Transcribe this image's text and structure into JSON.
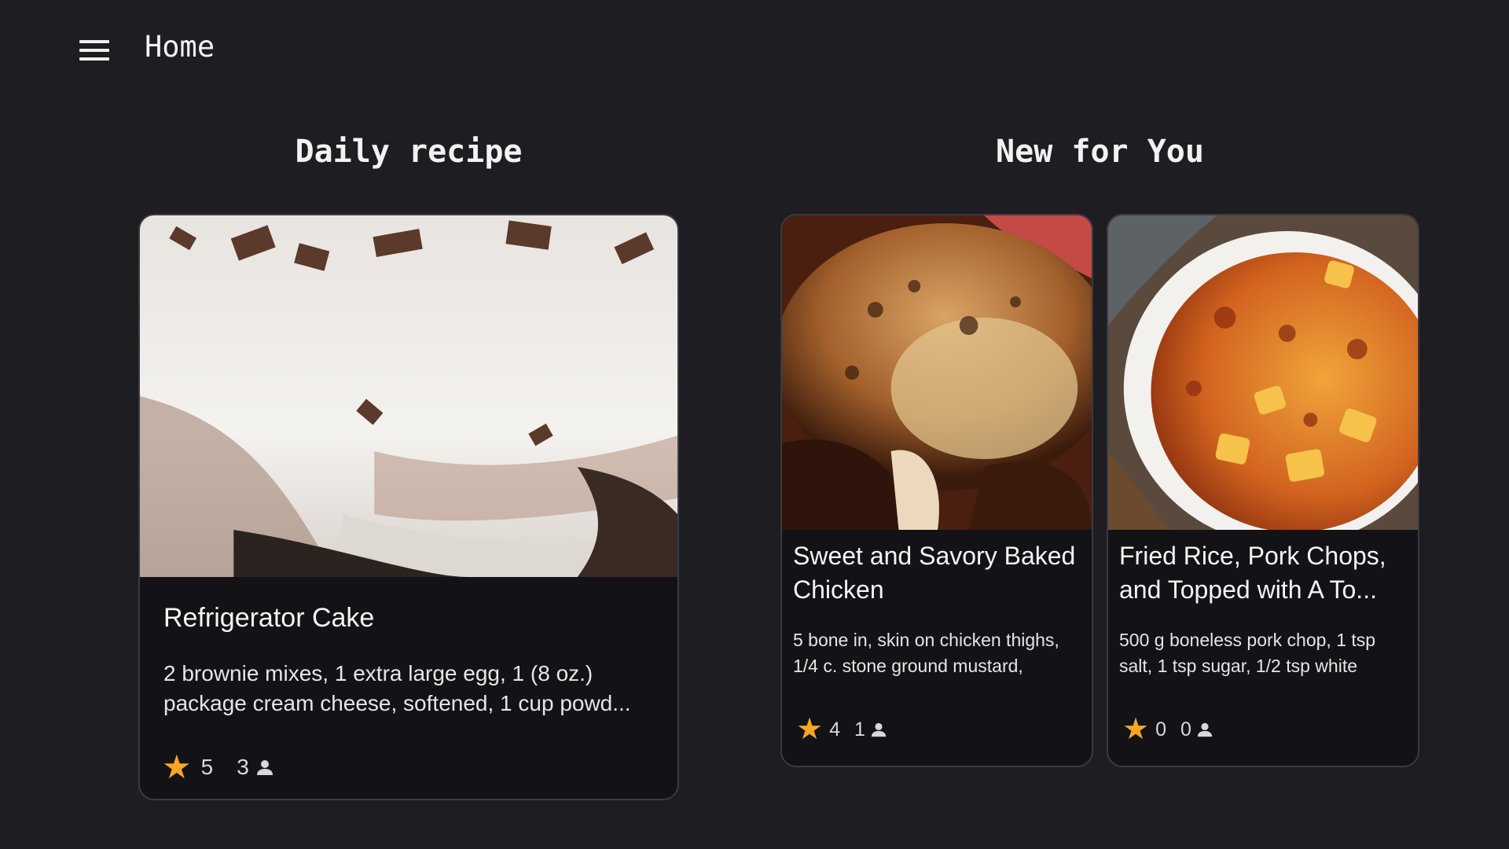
{
  "header": {
    "title": "Home",
    "menu_icon": "hamburger-menu-icon"
  },
  "sections": {
    "daily": {
      "title": "Daily recipe"
    },
    "new_for_you": {
      "title": "New for You"
    }
  },
  "daily_recipe": {
    "title": "Refrigerator Cake",
    "description": "2 brownie mixes, 1 extra large egg, 1 (8 oz.) package cream cheese, softened, 1 cup powd...",
    "rating": "5",
    "reviews": "3"
  },
  "new_recipes": [
    {
      "title": "Sweet and Savory Baked Chicken",
      "description": "5 bone in, skin on chicken thighs, 1/4 c. stone ground mustard,",
      "rating": "4",
      "reviews": "1"
    },
    {
      "title": "Fried Rice, Pork Chops, and Topped with A To...",
      "description": "500 g boneless pork chop, 1 tsp salt, 1 tsp sugar, 1/2 tsp white",
      "rating": "0",
      "reviews": "0"
    }
  ],
  "colors": {
    "background": "#1d1d22",
    "card": "#121217",
    "star": "#f5a623"
  }
}
